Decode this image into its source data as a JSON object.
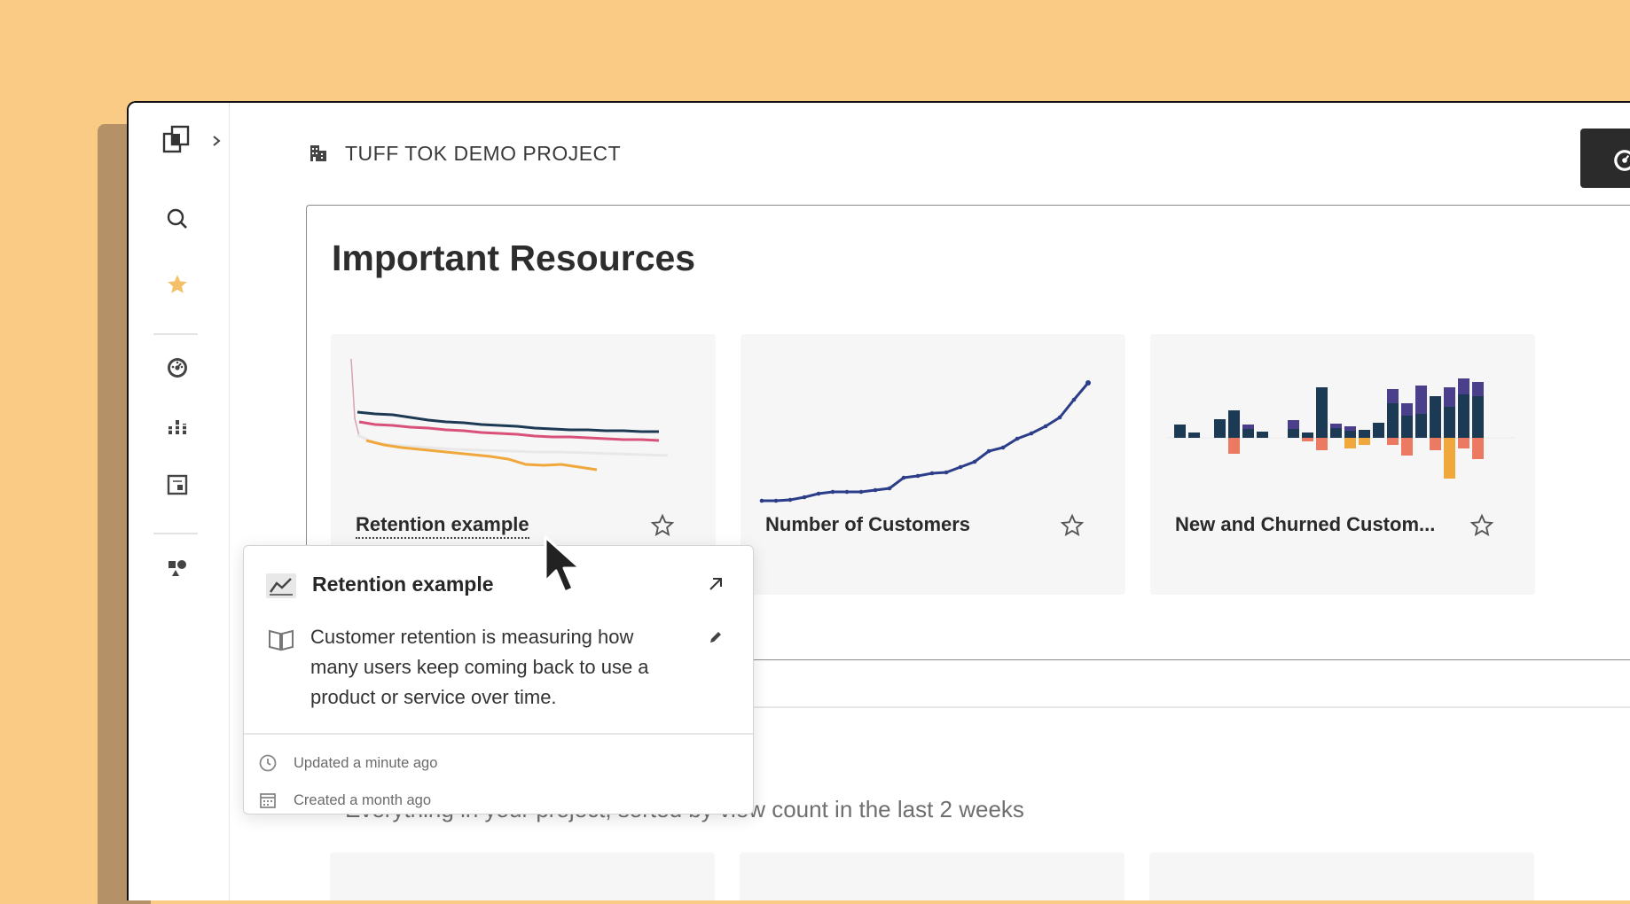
{
  "header": {
    "project_title": "TUFF TOK DEMO PROJECT"
  },
  "sidebar": {
    "items": [
      {
        "icon": "search-icon"
      },
      {
        "icon": "star-icon"
      },
      {
        "icon": "dashboard-gauge-icon"
      },
      {
        "icon": "bar-chart-icon"
      },
      {
        "icon": "report-icon"
      },
      {
        "icon": "shapes-icon"
      }
    ]
  },
  "panel": {
    "title": "Important Resources",
    "cards": [
      {
        "label": "Retention example"
      },
      {
        "label": "Number of Customers"
      },
      {
        "label": "New and Churned Custom..."
      }
    ]
  },
  "popup": {
    "title": "Retention example",
    "description": "Customer retention is measuring how many users keep coming back to use a product or service over time.",
    "updated": "Updated a minute ago",
    "created": "Created a month ago"
  },
  "list_subtitle": "Everything in your project, sorted by view count in the last 2 weeks",
  "colors": {
    "background": "#FACB85",
    "accent_dark": "#1d3a55",
    "pink": "#d9517a",
    "orange": "#f0a83c",
    "blue": "#2c3e8a",
    "purple": "#4a3f8a",
    "coral": "#ec7a62",
    "star": "#F4C06A"
  }
}
